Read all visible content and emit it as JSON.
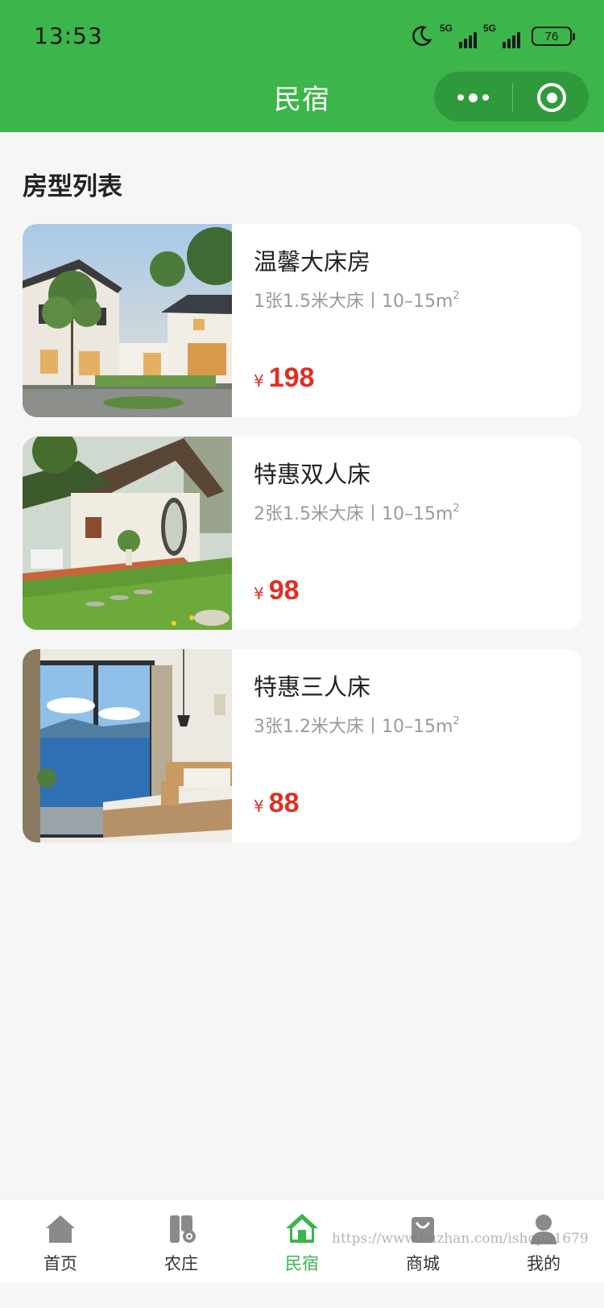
{
  "status_bar": {
    "time": "13:53",
    "network_1": "5G",
    "network_2": "5G",
    "battery": "76"
  },
  "nav": {
    "title": "民宿"
  },
  "section": {
    "title": "房型列表"
  },
  "rooms": [
    {
      "name": "温馨大床房",
      "desc": "1张1.5米大床丨10–15m",
      "desc_sup": "2",
      "currency": "¥",
      "price": "198"
    },
    {
      "name": "特惠双人床",
      "desc": "2张1.5米大床丨10–15m",
      "desc_sup": "2",
      "currency": "¥",
      "price": "98"
    },
    {
      "name": "特惠三人床",
      "desc": "3张1.2米大床丨10–15m",
      "desc_sup": "2",
      "currency": "¥",
      "price": "88"
    }
  ],
  "tabbar": {
    "items": [
      {
        "label": "首页",
        "icon": "home-icon",
        "active": false
      },
      {
        "label": "农庄",
        "icon": "farm-icon",
        "active": false
      },
      {
        "label": "民宿",
        "icon": "homestay-icon",
        "active": true
      },
      {
        "label": "商城",
        "icon": "shop-bag-icon",
        "active": false
      },
      {
        "label": "我的",
        "icon": "user-icon",
        "active": false
      }
    ]
  },
  "watermark": "https://www.huzhan.com/ishop31679",
  "colors": {
    "brand_green": "#3cb54a",
    "price_red": "#e02e24",
    "inactive_icon": "#8a8a8a"
  }
}
